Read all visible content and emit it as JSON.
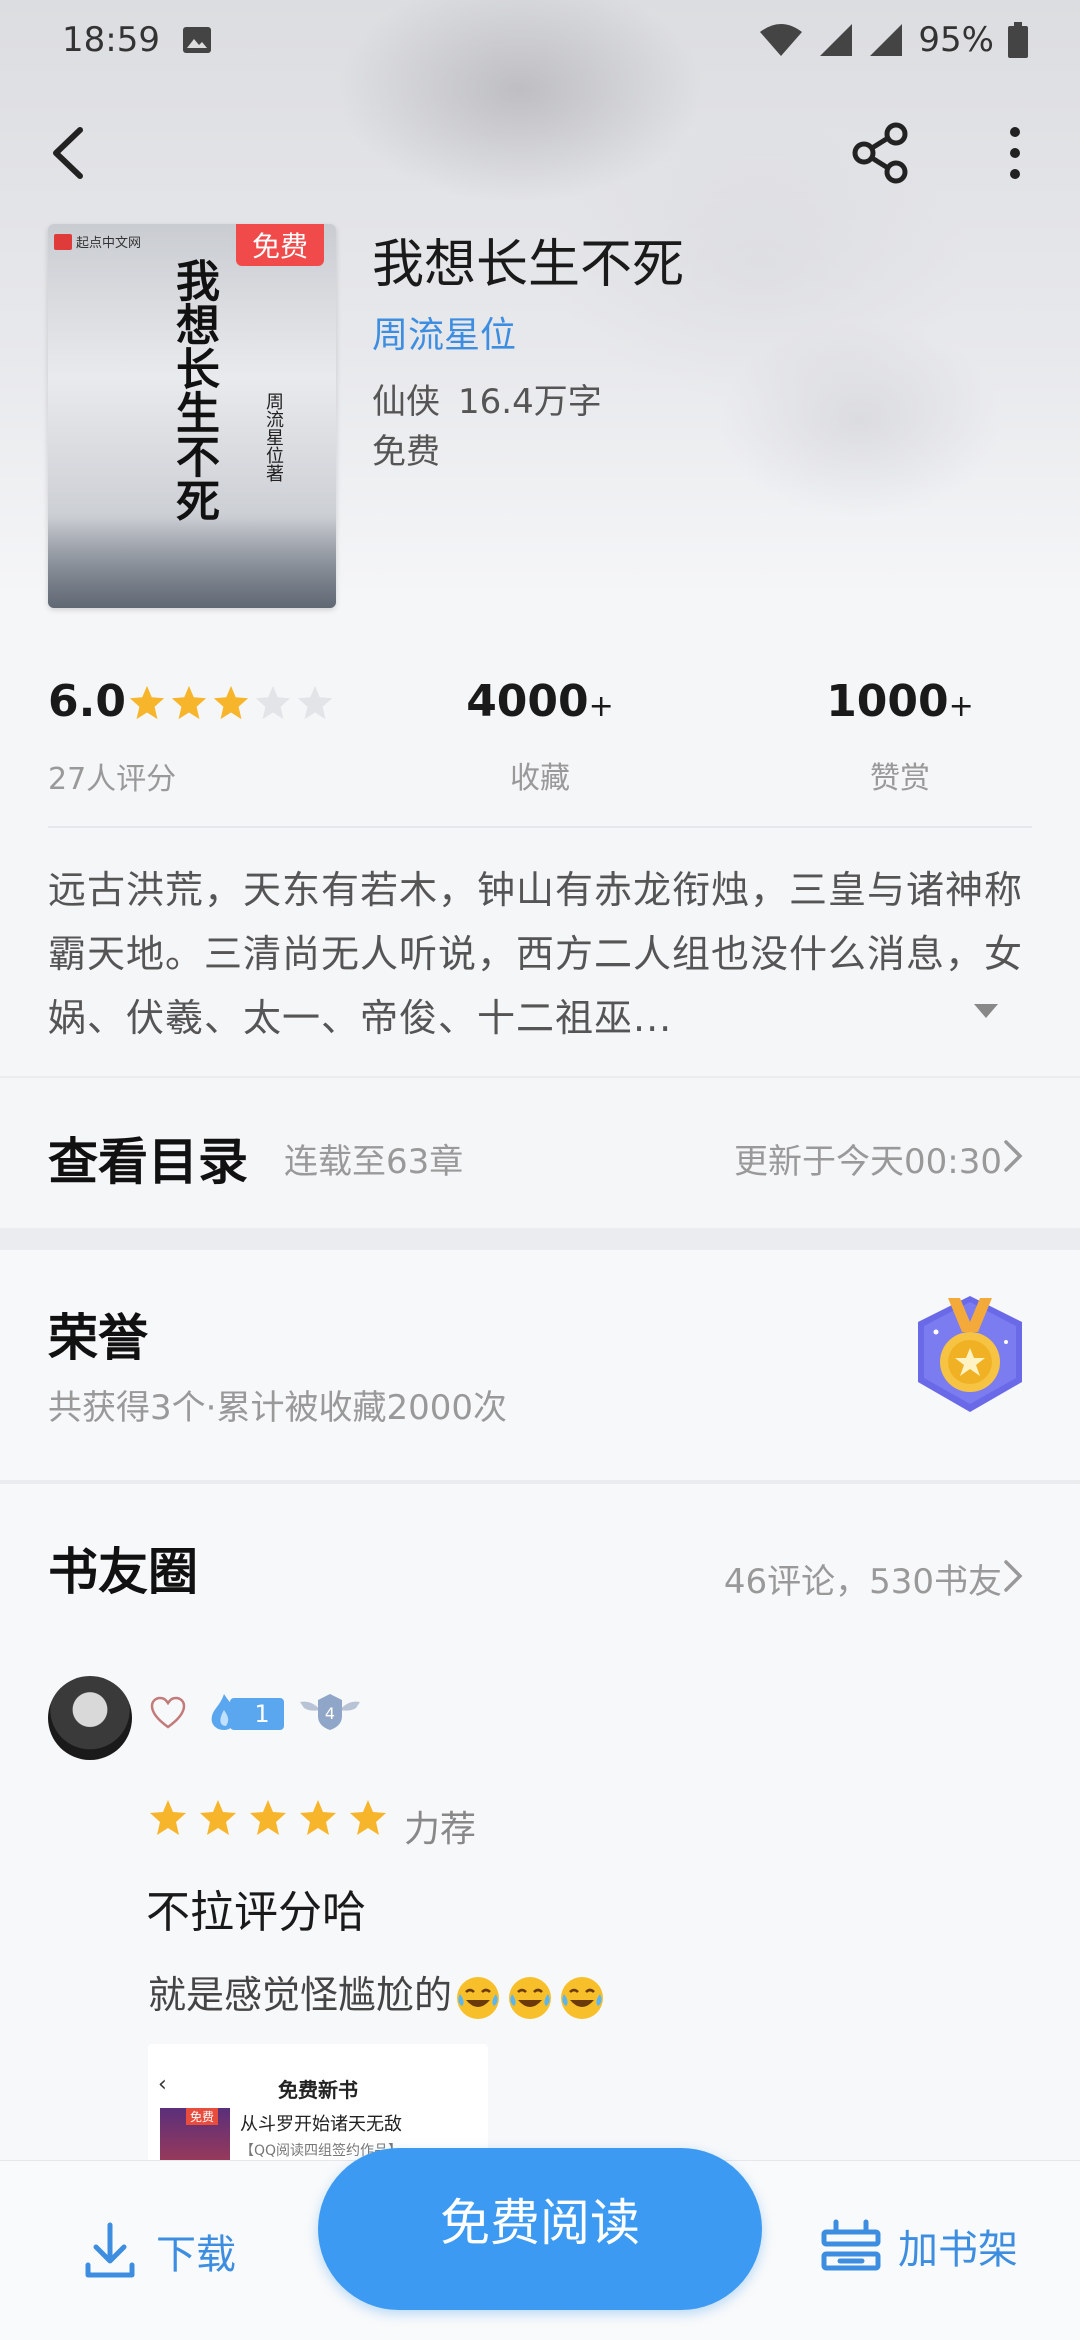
{
  "status_bar": {
    "time": "18:59",
    "battery": "95%"
  },
  "book": {
    "title": "我想长生不死",
    "author": "周流星位",
    "genre": "仙侠",
    "word_count": "16.4万字",
    "price": "免费",
    "cover": {
      "free_tag": "免费",
      "publisher": "起点中文网",
      "title": "我想长生不死",
      "author": "周流星位著"
    }
  },
  "stats": {
    "rating": "6.0",
    "rating_stars": 3,
    "rating_count": "27人评分",
    "collect_value": "4000",
    "collect_plus": "+",
    "collect_label": "收藏",
    "like_value": "1000",
    "like_plus": "+",
    "like_label": "赞赏"
  },
  "synopsis": "远古洪荒，天东有若木，钟山有赤龙衔烛，三皇与诸神称霸天地。三清尚无人听说，西方二人组也没什么消息，女娲、伏羲、太一、帝俊、十二祖巫...",
  "catalog": {
    "title": "查看目录",
    "status": "连载至63章",
    "update": "更新于今天00:30"
  },
  "honor": {
    "title": "荣誉",
    "subtitle": "共获得3个·累计被收藏2000次"
  },
  "circle": {
    "title": "书友圈",
    "stats": "46评论，530书友",
    "review": {
      "level": "1",
      "wing_level": "4",
      "stars": 5,
      "tag": "力荐",
      "title": "不拉评分哈",
      "body": "就是感觉怪尴尬的",
      "screenshot": {
        "title": "免费新书",
        "book_name": "从斗罗开始诸天无敌",
        "tag": "免费",
        "subtitle": "【QQ阅读四组签约作品】"
      }
    }
  },
  "bottom_bar": {
    "download": "下载",
    "read": "免费阅读",
    "shelf": "加书架"
  },
  "colors": {
    "accent": "#3d9af2",
    "link": "#3d8ee0",
    "star": "#f7b52c",
    "free_tag": "#f04a4a"
  }
}
